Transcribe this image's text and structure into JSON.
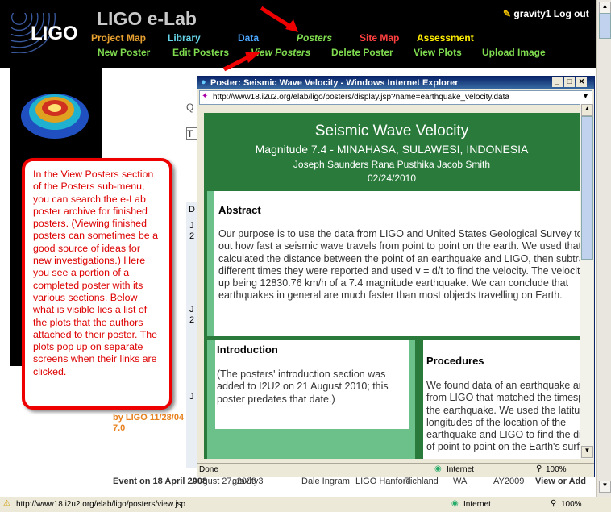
{
  "header": {
    "logo_text": "LIGO",
    "brand": "LIGO e-Lab",
    "user": "gravity1",
    "logout": "Log out",
    "nav_top": [
      {
        "label": "Project Map",
        "color": "#e8a030"
      },
      {
        "label": "Library",
        "color": "#66d4e8"
      },
      {
        "label": "Data",
        "color": "#4da6ff"
      },
      {
        "label": "Posters",
        "color": "#7fdc4f"
      },
      {
        "label": "Site Map",
        "color": "#ff4040"
      },
      {
        "label": "Assessment",
        "color": "#ffee00"
      }
    ],
    "nav_sub": [
      "New Poster",
      "Edit Posters",
      "View Posters",
      "Delete Poster",
      "View Plots",
      "Upload Image"
    ]
  },
  "background_page": {
    "fragments": [
      "Q",
      "T",
      "D",
      "J",
      "2",
      "J",
      "2",
      "J",
      "by LIGO 11/28/04",
      "7.0"
    ],
    "bottom_row": [
      "Event on 18 April 2008",
      "August 27, 2009",
      "gravity3",
      "Dale Ingram",
      "LIGO Hanford",
      "Richland",
      "WA",
      "AY2009",
      "View or Add"
    ]
  },
  "callout": "In the View Posters section of the Posters sub-menu, you can search the e-Lab poster archive for finished posters. (Viewing finished posters can sometimes be a good source of ideas for new investigations.)  Here you see a portion of a completed poster with its various sections.  Below what is visible lies a list of the plots that the authors attached to their poster. The plots pop up on separate screens when their links are clicked.",
  "popup": {
    "title": "Poster: Seismic Wave Velocity - Windows Internet Explorer",
    "url": "http://www18.i2u2.org/elab/ligo/posters/display.jsp?name=earthquake_velocity.data",
    "status": "Done",
    "zone": "Internet",
    "zoom": "100%"
  },
  "poster": {
    "title": "Seismic Wave Velocity",
    "subtitle": "Magnitude 7.4 - MINAHASA, SULAWESI, INDONESIA",
    "authors": "Joseph Saunders Rana Pusthika Jacob Smith",
    "date": "02/24/2010",
    "abstract_heading": "Abstract",
    "abstract_lines": [
      "Our purpose is to use the data from LIGO and United States Geological Survey to",
      "out how fast a seismic wave travels from point to point on the earth. We used that d",
      "calculated the distance between the point of an earthquake and LIGO, then subtrac",
      "different times they were reported and used v = d/t to find the velocity. The velocity",
      "up being 12830.76 km/h of a 7.4 magnitude earthquake. We can conclude that",
      "earthquakes in general are much faster than most objects travelling on Earth."
    ],
    "intro_heading": "Introduction",
    "intro_lines": [
      "(The posters' introduction section was",
      "added to I2U2 on 21 August 2010; this",
      "poster predates that date.)"
    ],
    "proc_heading": "Procedures",
    "proc_lines": [
      "We found data of an earthquake ar",
      "from LIGO that matched the timesp",
      "the earthquake. We used the latitu",
      "longitudes of the location of the",
      "earthquake and LIGO to find the di",
      "of point to point on the Earth's surf"
    ]
  },
  "statusbar": {
    "url": "http://www18.i2u2.org/elab/ligo/posters/view.jsp",
    "zone": "Internet",
    "zoom": "100%"
  }
}
